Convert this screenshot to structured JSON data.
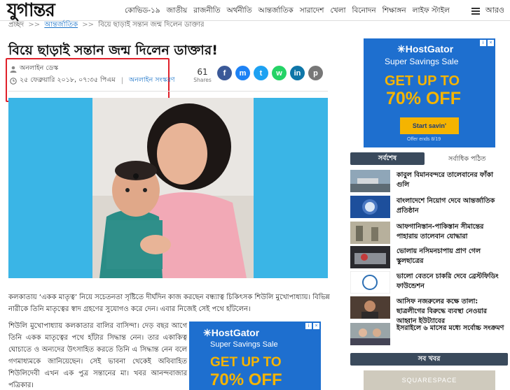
{
  "header": {
    "logo": "যুগান্তর",
    "nav": [
      "কোভিড-১৯",
      "জাতীয়",
      "রাজনীতি",
      "অর্থনীতি",
      "আন্তর্জাতিক",
      "সারাদেশ",
      "খেলা",
      "বিনোদন",
      "শিক্ষাঙ্গন",
      "লাইফ স্টাইল"
    ],
    "more_label": "আরও"
  },
  "breadcrumb": {
    "home": "প্রচ্ছদ",
    "sep": ">>",
    "category": "আন্তর্জাতিক",
    "current": "বিয়ে ছাড়াই সন্তান জন্ম দিলেন ডাক্তার"
  },
  "article": {
    "headline": "বিয়ে ছাড়াই সন্তান জন্ম দিলেন ডাক্তার!",
    "author": "অনলাইন ডেস্ক",
    "date": "২৫ ফেব্রুয়ারি ২০১৮, ০৭:৩৫ পিএম",
    "version": "অনলাইন সংস্করণ",
    "shares_count": "61",
    "shares_label": "Shares",
    "paragraph1": "কলকাতায় ‘একক মাতৃত্ব’ নিয়ে সচেতনতা সৃষ্টিতে দীর্ঘদিন কাজ করছেন বন্ধ্যাত্ব চিকিৎসক শিউলি মুখোপাধ্যায়। বিভিন্ন নারীকে তিনি মাতৃত্বের স্বাদ গ্রহণের সুযোগও করে দেন। এবার নিজেই সেই পথে হাঁটলেন।",
    "paragraph2": "শিউলি মুখোপাধ্যায় কলকাতার বালির বাসিন্দা। দেড় বছর আগে তিনি একক মাতৃত্বের পথে হাঁটার সিদ্ধান্ত নেন। তার একাকিত্ব ঘোচাতে ও অন্যদের উৎসাহিত করতে তিনি এ সিদ্ধান্ত নেন বলে গণমাধ্যমকে জানিয়েছেন। সেই ভাবনা থেকেই অবিবাহিত শিউলিদেবী এখন এক পুত্র সন্তানের মা। খবর আনন্দবাজার পত্রিকার।"
  },
  "share_icons": [
    {
      "name": "facebook-icon",
      "glyph": "f",
      "color": "#3b5998"
    },
    {
      "name": "messenger-icon",
      "glyph": "m",
      "color": "#1d82f5"
    },
    {
      "name": "twitter-icon",
      "glyph": "t",
      "color": "#1da1f2"
    },
    {
      "name": "whatsapp-icon",
      "glyph": "w",
      "color": "#25d366"
    },
    {
      "name": "linkedin-icon",
      "glyph": "in",
      "color": "#0e76a8"
    },
    {
      "name": "print-icon",
      "glyph": "p",
      "color": "#777777"
    }
  ],
  "ad": {
    "brand": "HostGator",
    "subtitle": "Super Savings Sale",
    "headline1": "GET UP TO",
    "headline2": "70% OFF",
    "cta": "Start savin'",
    "fine": "Offer ends 8/19"
  },
  "sidebar": {
    "tab_latest": "সর্বশেষ",
    "tab_popular": "সর্বাধিক পঠিত",
    "news": [
      "কাবুল বিমানবন্দরে তালেবানের ফাঁকা গুলি",
      "বাংলাদেশে নিয়োগ দেবে আন্তর্জাতিক প্রতিষ্ঠান",
      "আফগানিস্তান-পাকিস্তান সীমান্তের পাহারায় তালেবান যোদ্ধারা",
      "ভোলায় নসিমনচাপায় প্রাণ গেল স্কুলছাত্রের",
      "ভালো বেতনে চাকরি দেবে ব্রেস্টফিডিং ফাউন্ডেশন",
      "আসিফ নজরুলের কক্ষে তালা: ছাত্রলীগের বিরুদ্ধে ব্যবস্থা নেওয়ার আহ্বান ইউট্যাবের",
      "ইসরাইলে ৬ মাসের মধ্যে সর্বোচ্চ সংক্রমণ"
    ],
    "all_news": "সব খবর",
    "bottom_ad": "SQUARESPACE"
  },
  "colors": {
    "highlight_border": "#e0202a",
    "link": "#1a73c9",
    "tab_bg": "#3a4a5c",
    "ad_blue": "#1e6fcf",
    "ad_yellow": "#f5b400"
  }
}
